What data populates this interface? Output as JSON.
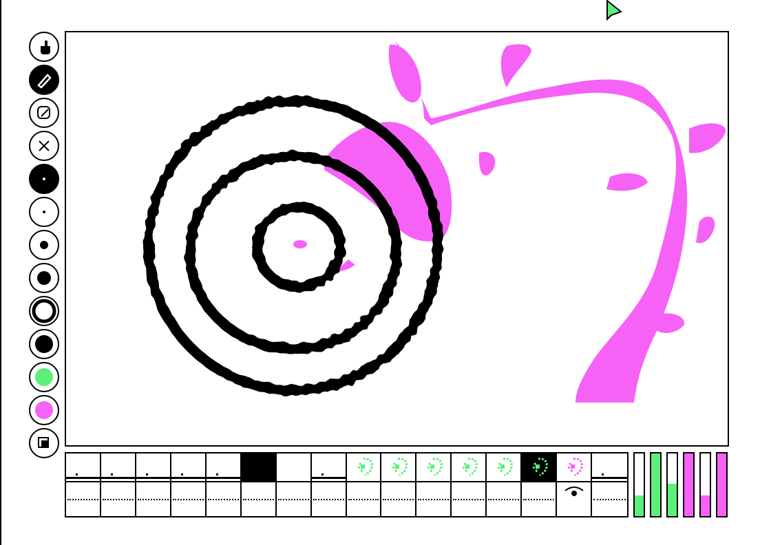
{
  "colors": {
    "ink": "#000000",
    "paper": "#ffffff",
    "magenta": "#f661f6",
    "green": "#5cf07a"
  },
  "toolbar": {
    "tools": [
      {
        "name": "hand-tool-icon",
        "selected": false
      },
      {
        "name": "pencil-tool-icon",
        "selected": true
      },
      {
        "name": "eraser-tool-icon",
        "selected": false
      },
      {
        "name": "clear-x-tool-icon",
        "selected": false
      },
      {
        "name": "brush-size-large-icon",
        "selected": false
      },
      {
        "name": "brush-size-tiny-icon",
        "selected": false
      },
      {
        "name": "brush-size-small-icon",
        "selected": false
      },
      {
        "name": "brush-size-medium-icon",
        "selected": false
      },
      {
        "name": "brush-size-ring-icon",
        "selected": false
      },
      {
        "name": "color-black-swatch-icon",
        "selected": false
      },
      {
        "name": "color-green-swatch-icon",
        "selected": false
      },
      {
        "name": "color-magenta-swatch-icon",
        "selected": false
      },
      {
        "name": "layer-copy-tool-icon",
        "selected": false
      }
    ]
  },
  "timeline": {
    "frames": [
      {
        "content": "ground",
        "selected": false
      },
      {
        "content": "ground",
        "selected": false
      },
      {
        "content": "ground",
        "selected": false
      },
      {
        "content": "ground",
        "selected": false
      },
      {
        "content": "ground",
        "selected": false
      },
      {
        "content": "blank",
        "selected": true
      },
      {
        "content": "blank",
        "selected": false
      },
      {
        "content": "ground",
        "selected": false
      },
      {
        "content": "green-sprite",
        "selected": false
      },
      {
        "content": "green-sprite",
        "selected": false
      },
      {
        "content": "green-sprite",
        "selected": false
      },
      {
        "content": "green-sprite",
        "selected": false
      },
      {
        "content": "green-sprite",
        "selected": false
      },
      {
        "content": "green-sprite",
        "selected": true
      },
      {
        "content": "magenta-sprite",
        "selected": false
      },
      {
        "content": "ground",
        "selected": false
      }
    ],
    "tracks": [
      {
        "marker": "none"
      },
      {
        "marker": "none"
      },
      {
        "marker": "none"
      },
      {
        "marker": "none"
      },
      {
        "marker": "none"
      },
      {
        "marker": "none"
      },
      {
        "marker": "none"
      },
      {
        "marker": "none"
      },
      {
        "marker": "none"
      },
      {
        "marker": "none"
      },
      {
        "marker": "none"
      },
      {
        "marker": "none"
      },
      {
        "marker": "none"
      },
      {
        "marker": "none"
      },
      {
        "marker": "eye-icon"
      },
      {
        "marker": "none"
      }
    ]
  },
  "meters": [
    {
      "color": "green",
      "level": 0.33
    },
    {
      "color": "green",
      "level": 1.0
    },
    {
      "color": "green",
      "level": 0.52
    },
    {
      "color": "magenta",
      "level": 1.0
    },
    {
      "color": "magenta",
      "level": 0.33
    },
    {
      "color": "magenta",
      "level": 1.0
    }
  ]
}
